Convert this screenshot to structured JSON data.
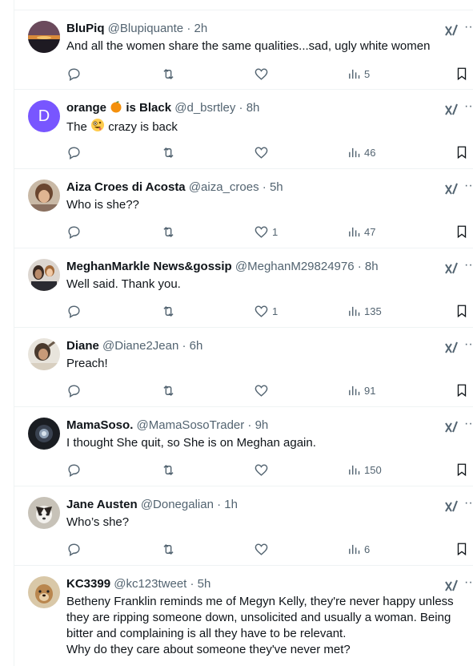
{
  "tweets": [
    {
      "name": "BluPiq",
      "handle": "@Blupiquante",
      "sep": "·",
      "time": "2h",
      "text": "And all the women share the same qualities...sad, ugly white women",
      "likes": "",
      "views": "5",
      "avatar": "sunset",
      "avatar_letter": ""
    },
    {
      "name_before": "orange",
      "name_after": "is Black",
      "emoji_name": "orange-fruit-emoji",
      "handle": "@d_bsrtley",
      "sep": "·",
      "time": "8h",
      "text_before": "The",
      "text_after": "crazy is back",
      "emoji_text": "zany-face-emoji",
      "likes": "",
      "views": "46",
      "avatar": "letter",
      "avatar_letter": "D"
    },
    {
      "name": "Aiza Croes di Acosta",
      "handle": "@aiza_croes",
      "sep": "·",
      "time": "5h",
      "text": "Who is she??",
      "likes": "1",
      "views": "47",
      "avatar": "photo"
    },
    {
      "name": "MeghanMarkle News&gossip",
      "handle": "@MeghanM29824976",
      "sep": "·",
      "time": "8h",
      "text": "Well said. Thank you.",
      "likes": "1",
      "views": "135",
      "avatar": "photo"
    },
    {
      "name": "Diane",
      "handle": "@Diane2Jean",
      "sep": "·",
      "time": "6h",
      "text": "Preach!",
      "likes": "",
      "views": "91",
      "avatar": "photo"
    },
    {
      "name": "MamaSoso.",
      "handle": "@MamaSosoTrader",
      "sep": "·",
      "time": "9h",
      "text": "I thought She quit, so She is on Meghan again.",
      "likes": "",
      "views": "150",
      "avatar": "dark"
    },
    {
      "name": "Jane Austen",
      "handle": "@Donegalian",
      "sep": "·",
      "time": "1h",
      "text": "Who’s she?",
      "likes": "",
      "views": "6",
      "avatar": "dog"
    },
    {
      "name": "KC3399",
      "handle": "@kc123tweet",
      "sep": "·",
      "time": "5h",
      "text": "Betheny Franklin reminds me of Megyn Kelly, they're never happy unless they are ripping someone down, unsolicited and usually a woman. Being bitter and complaining is all they have to be relevant.\nWhy do they care about someone they've never met?",
      "avatar": "dog"
    }
  ],
  "more_glyph": "···",
  "colors": {
    "text": "#0f1419",
    "muted": "#536471",
    "border": "#eff3f4",
    "accent_avatar": "#7856ff"
  }
}
